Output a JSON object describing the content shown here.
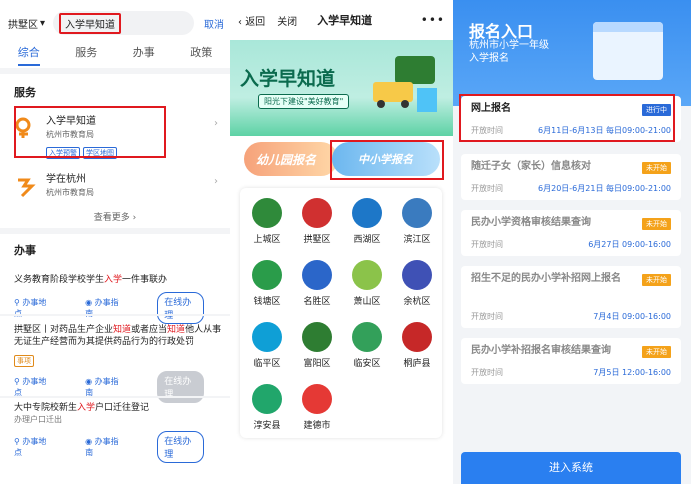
{
  "panel1": {
    "district": "拱墅区",
    "search_value": "入学早知道",
    "cancel": "取消",
    "tabs": [
      "综合",
      "服务",
      "办事",
      "政策"
    ],
    "service_title": "服务",
    "services": [
      {
        "title": "入学早知道",
        "dept": "杭州市教育局",
        "tags": [
          "入学预警",
          "学区地图"
        ]
      },
      {
        "title": "学在杭州",
        "dept": "杭州市教育局"
      }
    ],
    "more": "查看更多 ›",
    "affairs_title": "办事",
    "affairs": [
      {
        "pre": "义务教育阶段学校学生",
        "hl": "入学",
        "post": "一件事联办",
        "loc": "办事地点",
        "guide": "办事指南",
        "btn": "在线办理"
      },
      {
        "pre": "拱墅区丨对药品生产企业",
        "hl": "知道",
        "mid": "或者应当",
        "hl2": "知道",
        "post": "他人从事无证生产经营而为其提供药品行为的行政处罚",
        "badge": "事项",
        "loc": "办事地点",
        "guide": "办事指南",
        "btn": "在线办理"
      },
      {
        "pre": "大中专院校新生",
        "hl": "入学",
        "post": "户口迁往登记",
        "sub": "办理户口迁出",
        "loc": "办事地点",
        "guide": "办事指南",
        "btn": "在线办理"
      }
    ]
  },
  "panel2": {
    "back": "返回",
    "close": "关闭",
    "title": "入学早知道",
    "banner_title": "入学早知道",
    "banner_sub": "阳光下建设\"美好教育\"",
    "card1": "幼儿园报名",
    "card2": "中小学报名",
    "districts": [
      "上城区",
      "拱墅区",
      "西湖区",
      "滨江区",
      "钱塘区",
      "名胜区",
      "萧山区",
      "余杭区",
      "临平区",
      "富阳区",
      "临安区",
      "桐庐县",
      "淳安县",
      "建德市"
    ],
    "district_colors": [
      "#2f8a3a",
      "#d03030",
      "#1d77c8",
      "#3a7bbf",
      "#2a9c4a",
      "#2b66c9",
      "#8bc34a",
      "#3f51b5",
      "#0f9fd6",
      "#2e7d32",
      "#33a05a",
      "#c62828",
      "#21a66b",
      "#e53935"
    ]
  },
  "panel3": {
    "title": "报名入口",
    "subtitle1": "杭州市小学一年级",
    "subtitle2": "入学报名",
    "entries": [
      {
        "title": "网上报名",
        "status": "进行中",
        "label": "开放时间",
        "time": "6月11日-6月13日 每日09:00-21:00",
        "active": true
      },
      {
        "title": "随迁子女（家长）信息核对",
        "status": "未开始",
        "label": "开放时间",
        "time": "6月20日-6月21日 每日09:00-21:00",
        "active": false
      },
      {
        "title": "民办小学资格审核结果查询",
        "status": "未开始",
        "label": "开放时间",
        "time": "6月27日 09:00-16:00",
        "active": false
      },
      {
        "title": "招生不足的民办小学补招网上报名",
        "status": "未开始",
        "label": "开放时间",
        "time": "7月4日 09:00-16:00",
        "active": false
      },
      {
        "title": "民办小学补招报名审核结果查询",
        "status": "未开始",
        "label": "开放时间",
        "time": "7月5日 12:00-16:00",
        "active": false
      }
    ],
    "enter": "进入系统"
  },
  "colors": {
    "blue": "#2a6ad8",
    "red": "#e0191f",
    "orange": "#f4a21a"
  }
}
